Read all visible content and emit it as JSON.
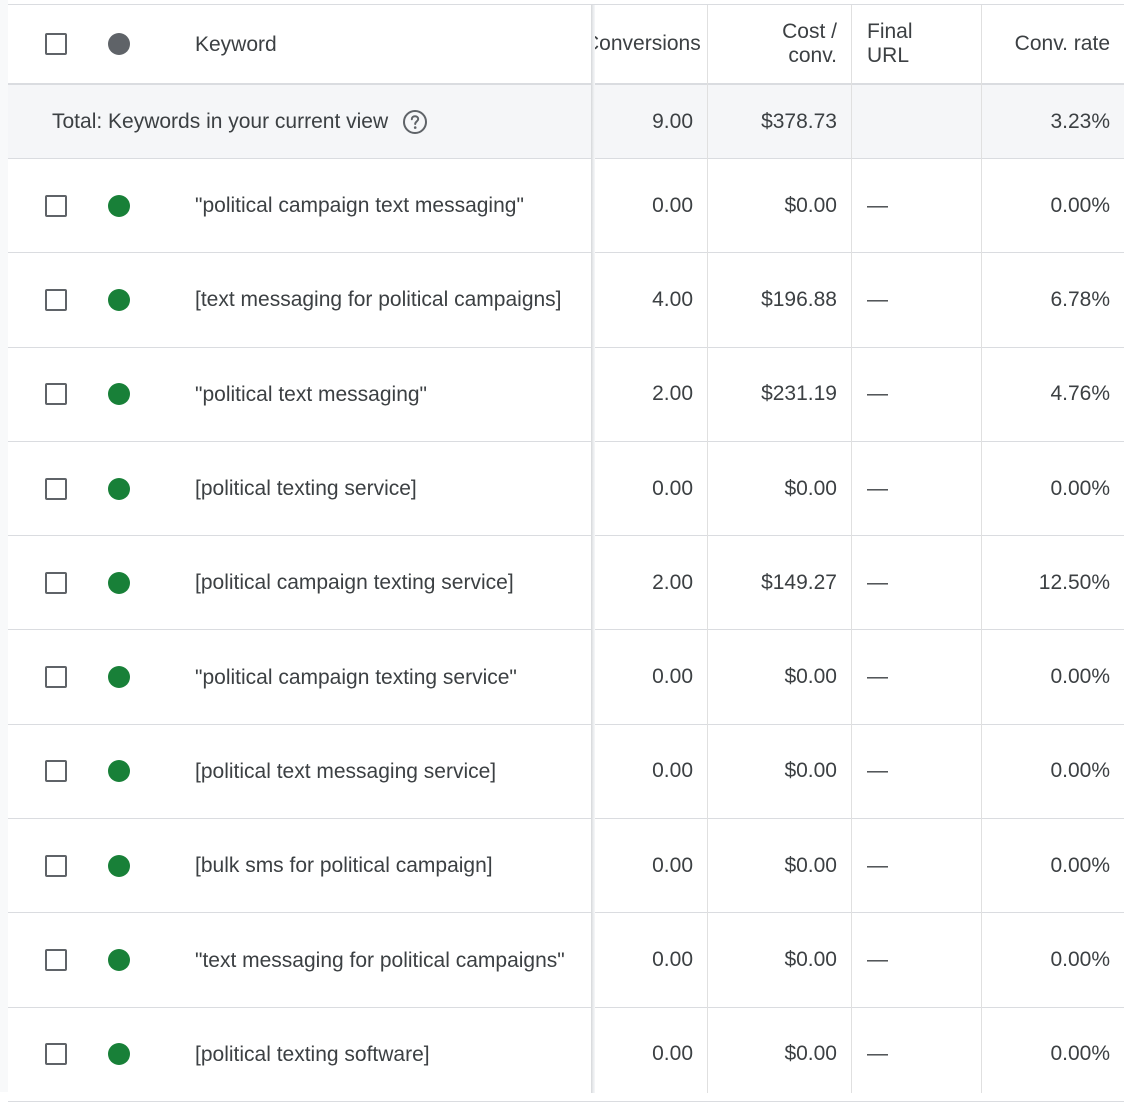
{
  "colors": {
    "status_enabled": "#188038",
    "status_header": "#5f6368",
    "border": "#dadce0",
    "total_bg": "#f5f6f8"
  },
  "header": {
    "keyword": "Keyword",
    "conversions": "Conversions",
    "cost_per_conv_line1": "Cost /",
    "cost_per_conv_line2": "conv.",
    "final_url_line1": "Final",
    "final_url_line2": "URL",
    "conv_rate": "Conv. rate",
    "select_all_icon": "checkbox-icon",
    "status_icon": "status-dot-icon"
  },
  "total": {
    "label": "Total: Keywords in your current view",
    "help_icon": "help-circle-icon",
    "conversions": "9.00",
    "cost_per_conv": "$378.73",
    "final_url": "",
    "conv_rate": "3.23%"
  },
  "rows": [
    {
      "keyword": "\"political campaign text messaging\"",
      "conversions": "0.00",
      "cost_per_conv": "$0.00",
      "final_url": "—",
      "conv_rate": "0.00%"
    },
    {
      "keyword": "[text messaging for political campaigns]",
      "conversions": "4.00",
      "cost_per_conv": "$196.88",
      "final_url": "—",
      "conv_rate": "6.78%"
    },
    {
      "keyword": "\"political text messaging\"",
      "conversions": "2.00",
      "cost_per_conv": "$231.19",
      "final_url": "—",
      "conv_rate": "4.76%"
    },
    {
      "keyword": "[political texting service]",
      "conversions": "0.00",
      "cost_per_conv": "$0.00",
      "final_url": "—",
      "conv_rate": "0.00%"
    },
    {
      "keyword": "[political campaign texting service]",
      "conversions": "2.00",
      "cost_per_conv": "$149.27",
      "final_url": "—",
      "conv_rate": "12.50%"
    },
    {
      "keyword": "\"political campaign texting service\"",
      "conversions": "0.00",
      "cost_per_conv": "$0.00",
      "final_url": "—",
      "conv_rate": "0.00%"
    },
    {
      "keyword": "[political text messaging service]",
      "conversions": "0.00",
      "cost_per_conv": "$0.00",
      "final_url": "—",
      "conv_rate": "0.00%"
    },
    {
      "keyword": "[bulk sms for political campaign]",
      "conversions": "0.00",
      "cost_per_conv": "$0.00",
      "final_url": "—",
      "conv_rate": "0.00%"
    },
    {
      "keyword": "\"text messaging for political campaigns\"",
      "conversions": "0.00",
      "cost_per_conv": "$0.00",
      "final_url": "—",
      "conv_rate": "0.00%"
    },
    {
      "keyword": "[political texting software]",
      "conversions": "0.00",
      "cost_per_conv": "$0.00",
      "final_url": "—",
      "conv_rate": "0.00%"
    }
  ]
}
